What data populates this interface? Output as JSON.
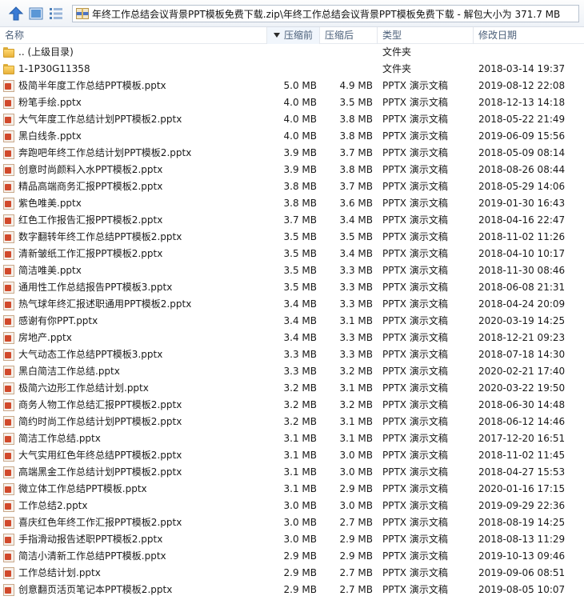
{
  "toolbar": {
    "icons": [
      "up-arrow-icon",
      "view-icon",
      "list-view-icon"
    ],
    "address": "年终工作总结会议背景PPT模板免费下载.zip\\年终工作总结会议背景PPT模板免费下载 - 解包大小为 371.7 MB"
  },
  "columns": {
    "name": "名称",
    "packed": "压缩前",
    "size": "压缩后",
    "type": "类型",
    "date": "修改日期"
  },
  "rows": [
    {
      "name": ".. (上级目录)",
      "icon": "folder",
      "packed": "",
      "size": "",
      "type": "文件夹",
      "date": ""
    },
    {
      "name": "1-1P30G11358",
      "icon": "folder",
      "packed": "",
      "size": "",
      "type": "文件夹",
      "date": "2018-03-14 19:37"
    },
    {
      "name": "极简半年度工作总结PPT模板.pptx",
      "icon": "ppt",
      "packed": "5.0 MB",
      "size": "4.9 MB",
      "type": "PPTX 演示文稿",
      "date": "2019-08-12 22:08"
    },
    {
      "name": "粉笔手绘.pptx",
      "icon": "ppt",
      "packed": "4.0 MB",
      "size": "3.5 MB",
      "type": "PPTX 演示文稿",
      "date": "2018-12-13 14:18"
    },
    {
      "name": "大气年度工作总结计划PPT模板2.pptx",
      "icon": "ppt",
      "packed": "4.0 MB",
      "size": "3.8 MB",
      "type": "PPTX 演示文稿",
      "date": "2018-05-22 21:49"
    },
    {
      "name": "黑白线条.pptx",
      "icon": "ppt",
      "packed": "4.0 MB",
      "size": "3.8 MB",
      "type": "PPTX 演示文稿",
      "date": "2019-06-09 15:56"
    },
    {
      "name": "奔跑吧年终工作总结计划PPT模板2.pptx",
      "icon": "ppt",
      "packed": "3.9 MB",
      "size": "3.7 MB",
      "type": "PPTX 演示文稿",
      "date": "2018-05-09 08:14"
    },
    {
      "name": "创意时尚颜料入水PPT模板2.pptx",
      "icon": "ppt",
      "packed": "3.9 MB",
      "size": "3.8 MB",
      "type": "PPTX 演示文稿",
      "date": "2018-08-26 08:44"
    },
    {
      "name": "精品高端商务汇报PPT模板2.pptx",
      "icon": "ppt",
      "packed": "3.8 MB",
      "size": "3.7 MB",
      "type": "PPTX 演示文稿",
      "date": "2018-05-29 14:06"
    },
    {
      "name": "紫色唯美.pptx",
      "icon": "ppt",
      "packed": "3.8 MB",
      "size": "3.6 MB",
      "type": "PPTX 演示文稿",
      "date": "2019-01-30 16:43"
    },
    {
      "name": "红色工作报告汇报PPT模板2.pptx",
      "icon": "ppt",
      "packed": "3.7 MB",
      "size": "3.4 MB",
      "type": "PPTX 演示文稿",
      "date": "2018-04-16 22:47"
    },
    {
      "name": "数字翻转年终工作总结PPT模板2.pptx",
      "icon": "ppt",
      "packed": "3.5 MB",
      "size": "3.5 MB",
      "type": "PPTX 演示文稿",
      "date": "2018-11-02 11:26"
    },
    {
      "name": "清新皱纸工作汇报PPT模板2.pptx",
      "icon": "ppt",
      "packed": "3.5 MB",
      "size": "3.4 MB",
      "type": "PPTX 演示文稿",
      "date": "2018-04-10 10:17"
    },
    {
      "name": "简洁唯美.pptx",
      "icon": "ppt",
      "packed": "3.5 MB",
      "size": "3.3 MB",
      "type": "PPTX 演示文稿",
      "date": "2018-11-30 08:46"
    },
    {
      "name": "通用性工作总结报告PPT模板3.pptx",
      "icon": "ppt",
      "packed": "3.5 MB",
      "size": "3.3 MB",
      "type": "PPTX 演示文稿",
      "date": "2018-06-08 21:31"
    },
    {
      "name": "热气球年终汇报述职通用PPT模板2.pptx",
      "icon": "ppt",
      "packed": "3.4 MB",
      "size": "3.3 MB",
      "type": "PPTX 演示文稿",
      "date": "2018-04-24 20:09"
    },
    {
      "name": "感谢有你PPT.pptx",
      "icon": "ppt",
      "packed": "3.4 MB",
      "size": "3.1 MB",
      "type": "PPTX 演示文稿",
      "date": "2020-03-19 14:25"
    },
    {
      "name": "房地产.pptx",
      "icon": "ppt",
      "packed": "3.4 MB",
      "size": "3.3 MB",
      "type": "PPTX 演示文稿",
      "date": "2018-12-21 09:23"
    },
    {
      "name": "大气动态工作总结PPT模板3.pptx",
      "icon": "ppt",
      "packed": "3.3 MB",
      "size": "3.3 MB",
      "type": "PPTX 演示文稿",
      "date": "2018-07-18 14:30"
    },
    {
      "name": "黑白简洁工作总结.pptx",
      "icon": "ppt",
      "packed": "3.3 MB",
      "size": "3.2 MB",
      "type": "PPTX 演示文稿",
      "date": "2020-02-21 17:40"
    },
    {
      "name": "极简六边形工作总结计划.pptx",
      "icon": "ppt",
      "packed": "3.2 MB",
      "size": "3.1 MB",
      "type": "PPTX 演示文稿",
      "date": "2020-03-22 19:50"
    },
    {
      "name": "商务人物工作总结汇报PPT模板2.pptx",
      "icon": "ppt",
      "packed": "3.2 MB",
      "size": "3.2 MB",
      "type": "PPTX 演示文稿",
      "date": "2018-06-30 14:48"
    },
    {
      "name": "简约时尚工作总结计划PPT模板2.pptx",
      "icon": "ppt",
      "packed": "3.2 MB",
      "size": "3.1 MB",
      "type": "PPTX 演示文稿",
      "date": "2018-06-12 14:46"
    },
    {
      "name": "简洁工作总结.pptx",
      "icon": "ppt",
      "packed": "3.1 MB",
      "size": "3.1 MB",
      "type": "PPTX 演示文稿",
      "date": "2017-12-20 16:51"
    },
    {
      "name": "大气实用红色年终总结PPT模板2.pptx",
      "icon": "ppt",
      "packed": "3.1 MB",
      "size": "3.0 MB",
      "type": "PPTX 演示文稿",
      "date": "2018-11-02 11:45"
    },
    {
      "name": "高端黑金工作总结计划PPT模板2.pptx",
      "icon": "ppt",
      "packed": "3.1 MB",
      "size": "3.0 MB",
      "type": "PPTX 演示文稿",
      "date": "2018-04-27 15:53"
    },
    {
      "name": "微立体工作总结PPT模板.pptx",
      "icon": "ppt",
      "packed": "3.1 MB",
      "size": "2.9 MB",
      "type": "PPTX 演示文稿",
      "date": "2020-01-16 17:15"
    },
    {
      "name": "工作总结2.pptx",
      "icon": "ppt",
      "packed": "3.0 MB",
      "size": "3.0 MB",
      "type": "PPTX 演示文稿",
      "date": "2019-09-29 22:36"
    },
    {
      "name": "喜庆红色年终工作汇报PPT模板2.pptx",
      "icon": "ppt",
      "packed": "3.0 MB",
      "size": "2.7 MB",
      "type": "PPTX 演示文稿",
      "date": "2018-08-19 14:25"
    },
    {
      "name": "手指滑动报告述职PPT模板2.pptx",
      "icon": "ppt",
      "packed": "3.0 MB",
      "size": "2.9 MB",
      "type": "PPTX 演示文稿",
      "date": "2018-08-13 11:29"
    },
    {
      "name": "简洁小清新工作总结PPT模板.pptx",
      "icon": "ppt",
      "packed": "2.9 MB",
      "size": "2.9 MB",
      "type": "PPTX 演示文稿",
      "date": "2019-10-13 09:46"
    },
    {
      "name": "工作总结计划.pptx",
      "icon": "ppt",
      "packed": "2.9 MB",
      "size": "2.7 MB",
      "type": "PPTX 演示文稿",
      "date": "2019-09-06 08:51"
    },
    {
      "name": "创意翻页活页笔记本PPT模板2.pptx",
      "icon": "ppt",
      "packed": "2.9 MB",
      "size": "2.7 MB",
      "type": "PPTX 演示文稿",
      "date": "2019-08-05 10:07"
    }
  ]
}
